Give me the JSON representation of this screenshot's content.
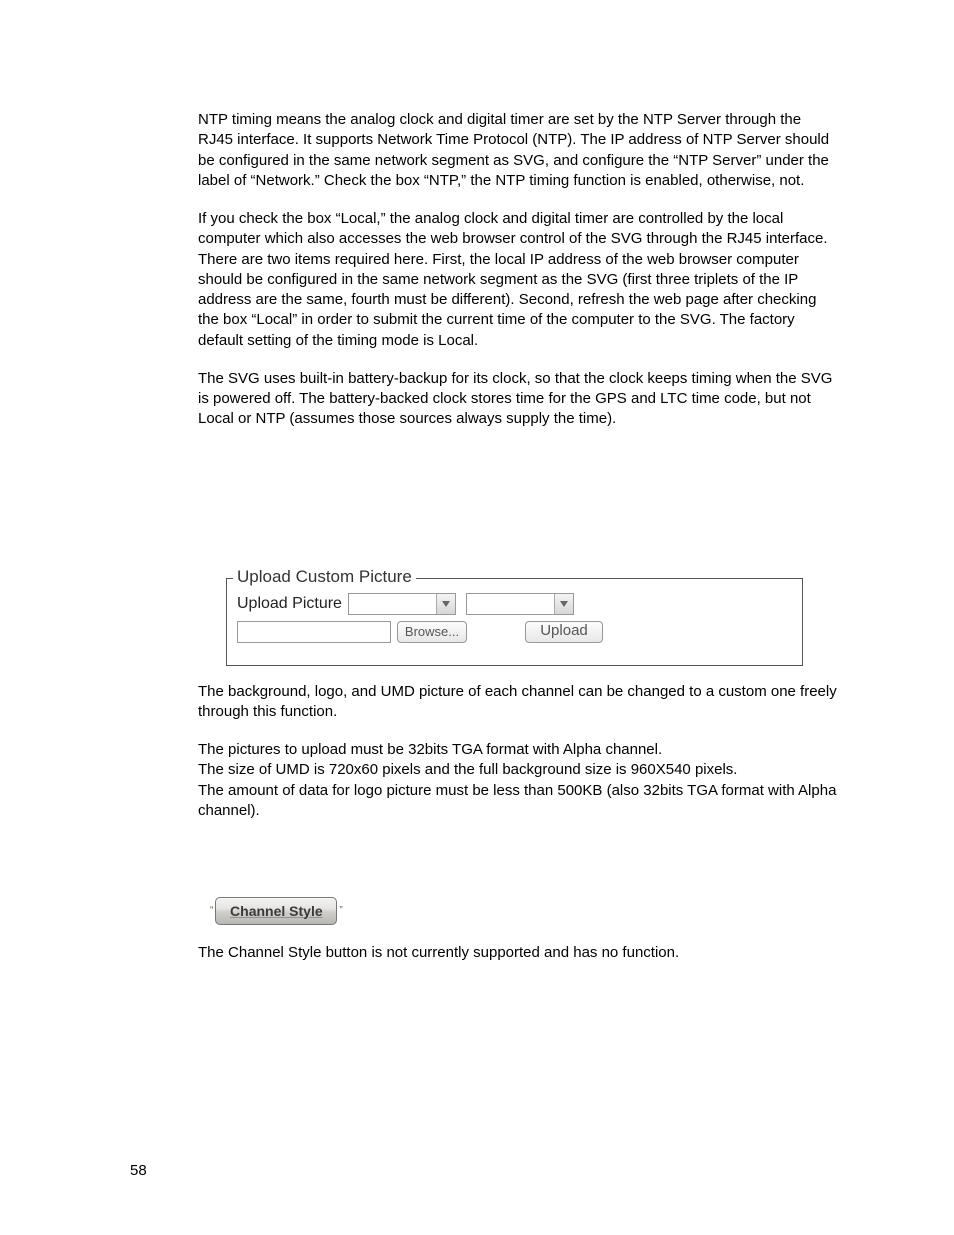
{
  "paragraphs": {
    "p1": "NTP timing means the analog clock and digital timer are set by the NTP Server through the RJ45 interface. It supports Network Time Protocol (NTP). The IP address of NTP Server should be configured in the same network segment as SVG, and configure the “NTP Server” under the label of “Network.” Check the box “NTP,” the NTP timing function is enabled, otherwise, not.",
    "p2": "If you check the box “Local,” the analog clock and digital timer are controlled by the local computer which also accesses the web browser control of the SVG through the RJ45 interface. There are two items required here. First, the local IP address of the web browser computer should be configured in the same network segment as the SVG (first three triplets of the IP address are the same, fourth must be different). Second, refresh the web page after checking the box “Local” in order to submit the current time of the computer to the SVG. The factory default setting of the timing mode is Local.",
    "p3": "The SVG uses built-in battery-backup for its clock, so that the clock keeps timing when the SVG is powered off. The battery-backed clock stores time for the GPS and LTC time code, but not Local or NTP (assumes those sources always supply the time).",
    "p4": "The background, logo, and UMD picture of each channel can be changed to a custom one freely through this function.",
    "p5a": "The pictures to upload must be 32bits TGA format with Alpha channel.",
    "p5b": "The size of UMD is 720x60 pixels and the full background size is 960X540 pixels.",
    "p5c": "The amount of data for logo picture must be less than 500KB (also 32bits TGA format with Alpha channel).",
    "p6": "The  Channel Style button is not currently supported and has no function."
  },
  "upload": {
    "legend": "Upload Custom Picture",
    "label": "Upload Picture",
    "browse": "Browse...",
    "upload_btn": "Upload"
  },
  "channel_style": {
    "label": "Channel Style"
  },
  "page_number": "58"
}
